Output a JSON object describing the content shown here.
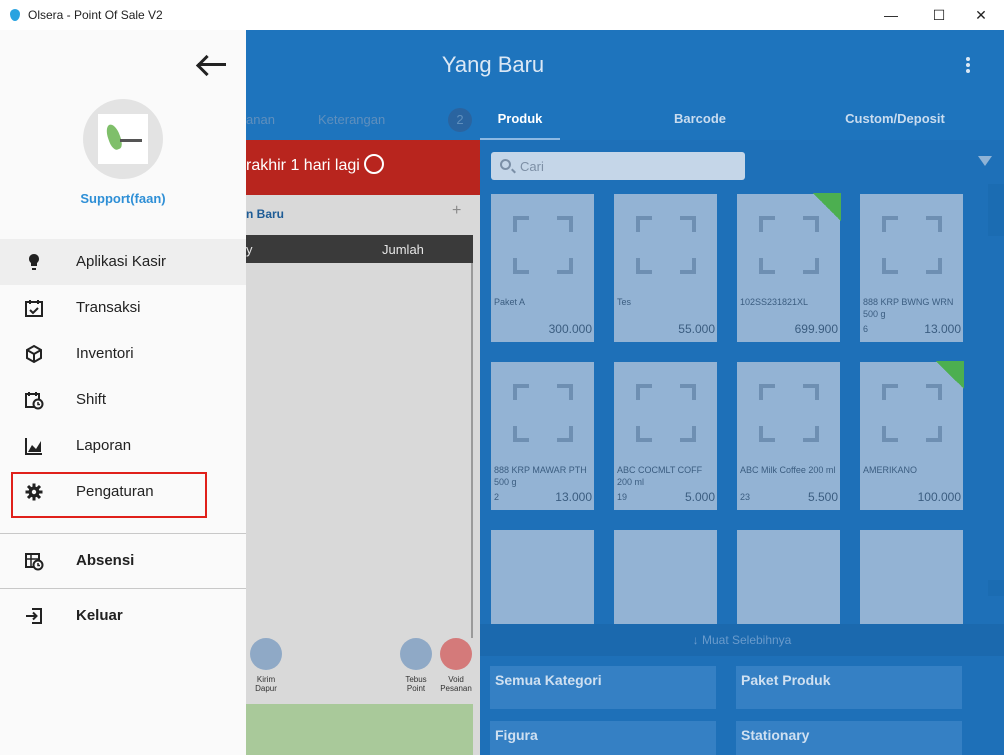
{
  "window": {
    "title": "Olsera - Point Of Sale V2",
    "controls": [
      "—",
      "☐",
      "✕"
    ]
  },
  "header": {
    "title": "Yang Baru",
    "left_tabs": [
      "anan",
      "Keterangan",
      "2"
    ],
    "tabs": [
      "Produk",
      "Barcode",
      "Custom/Deposit"
    ],
    "active_tab": "Produk"
  },
  "order_panel": {
    "banner": "rakhir 1 hari lagi",
    "order_title": "n Baru",
    "plus": "+",
    "column_left": "y",
    "column_right": "Jumlah",
    "buttons": [
      {
        "label": "Kirim\nDapur"
      },
      {
        "label": "Tebus\nPoint"
      },
      {
        "label": "Void\nPesanan"
      }
    ]
  },
  "products": {
    "search_placeholder": "Cari",
    "items": [
      {
        "name": "Paket A",
        "qty": "",
        "price": "300.000",
        "ribbon": false
      },
      {
        "name": "Tes",
        "qty": "",
        "price": "55.000",
        "ribbon": false
      },
      {
        "name": "102SS231821XL",
        "qty": "",
        "price": "699.900",
        "ribbon": true
      },
      {
        "name": "888 KRP BWNG WRN 500 g",
        "qty": "6",
        "price": "13.000",
        "ribbon": false
      },
      {
        "name": "888 KRP MAWAR PTH 500 g",
        "qty": "2",
        "price": "13.000",
        "ribbon": false
      },
      {
        "name": "ABC COCMLT COFF 200 ml",
        "qty": "19",
        "price": "5.000",
        "ribbon": false
      },
      {
        "name": "ABC Milk Coffee 200 ml",
        "qty": "23",
        "price": "5.500",
        "ribbon": false
      },
      {
        "name": "AMERIKANO",
        "qty": "",
        "price": "100.000",
        "ribbon": true
      }
    ],
    "load_more": "Muat Selebihnya",
    "categories": [
      "Semua Kategori",
      "Paket Produk",
      "Figura",
      "Stationary"
    ]
  },
  "drawer": {
    "username": "Support(faan)",
    "menu": [
      {
        "label": "Aplikasi Kasir",
        "icon": "lightbulb-icon",
        "active": true
      },
      {
        "label": "Transaksi",
        "icon": "calendar-check-icon",
        "active": false
      },
      {
        "label": "Inventori",
        "icon": "box-icon",
        "active": false
      },
      {
        "label": "Shift",
        "icon": "calendar-clock-icon",
        "active": false
      },
      {
        "label": "Laporan",
        "icon": "chart-area-icon",
        "active": false
      },
      {
        "label": "Pengaturan",
        "icon": "gear-icon",
        "active": false
      }
    ],
    "absensi": "Absensi",
    "keluar": "Keluar",
    "highlight_color": "#e0201a"
  }
}
